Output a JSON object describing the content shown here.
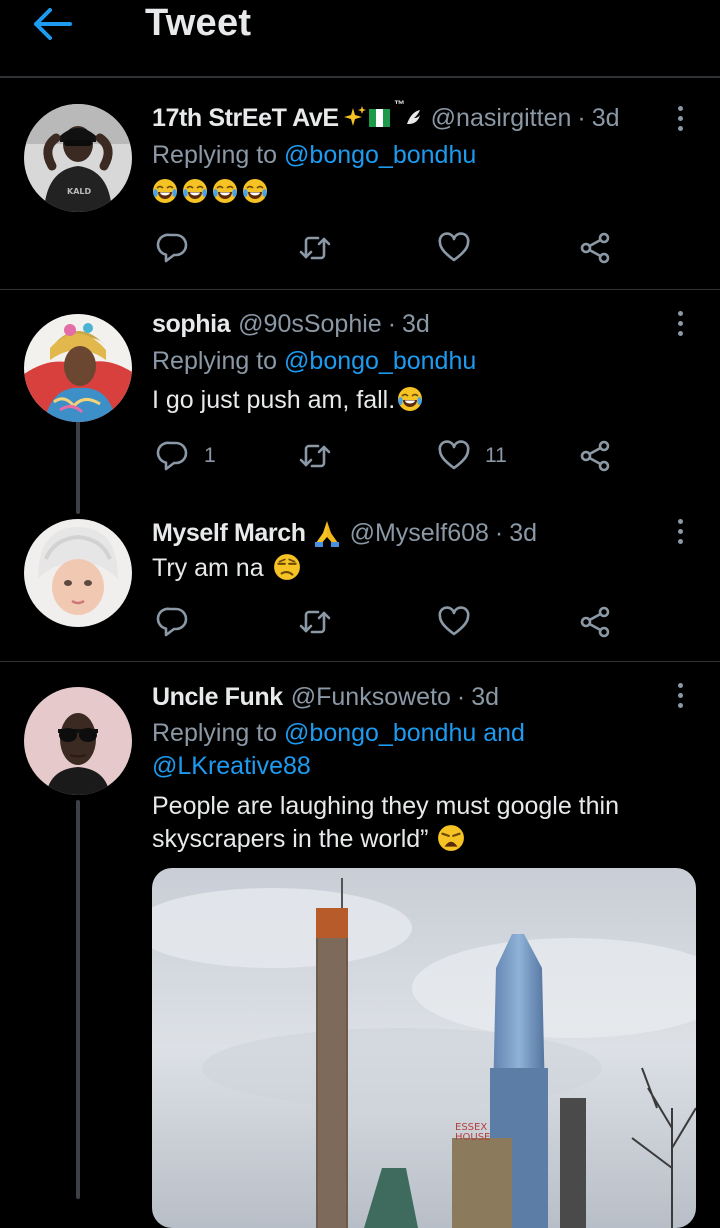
{
  "header": {
    "title": "Tweet",
    "back_icon": "arrow-left-icon",
    "accent": "#1d9bf0"
  },
  "tweets": [
    {
      "display_name": "17th StrEeT AvE",
      "name_emojis": [
        "sparkles",
        "flag-nigeria",
        "trademark",
        "dove"
      ],
      "trademark": "™",
      "handle": "@nasirgitten",
      "time": "3d",
      "reply_prefix": "Replying to",
      "reply_mention": "@bongo_bondhu",
      "emoji_count": 4,
      "emoji": "face-with-tears-of-joy",
      "reply_count": "",
      "retweet_count": "",
      "like_count": ""
    },
    {
      "display_name": "sophia",
      "handle": "@90sSophie",
      "time": "3d",
      "reply_prefix": "Replying to",
      "reply_mention": "@bongo_bondhu",
      "text": "I go just push am, fall.",
      "text_emoji": "face-with-tears-of-joy",
      "reply_count": "1",
      "retweet_count": "",
      "like_count": "11"
    },
    {
      "display_name": "Myself March",
      "name_emoji": "folded-hands",
      "handle": "@Myself608",
      "time": "3d",
      "text": "Try am na",
      "text_emoji": "unamused-face",
      "reply_count": "",
      "retweet_count": "",
      "like_count": ""
    },
    {
      "display_name": "Uncle Funk",
      "handle": "@Funksoweto",
      "time": "3d",
      "reply_prefix": "Replying to",
      "reply_mention_1": "@bongo_bondhu and",
      "reply_mention_2": "@LKreative88",
      "text_line_1": "People are laughing they must google thin",
      "text_line_2": "skyscrapers in the world”",
      "text_emoji": "weary-face",
      "image_sign": [
        "ESSEX",
        "HOUSE"
      ]
    }
  ],
  "dot_separator": "·",
  "icons": {
    "reply": "reply-icon",
    "retweet": "retweet-icon",
    "like": "heart-icon",
    "share": "share-icon",
    "more": "more-options-icon"
  }
}
